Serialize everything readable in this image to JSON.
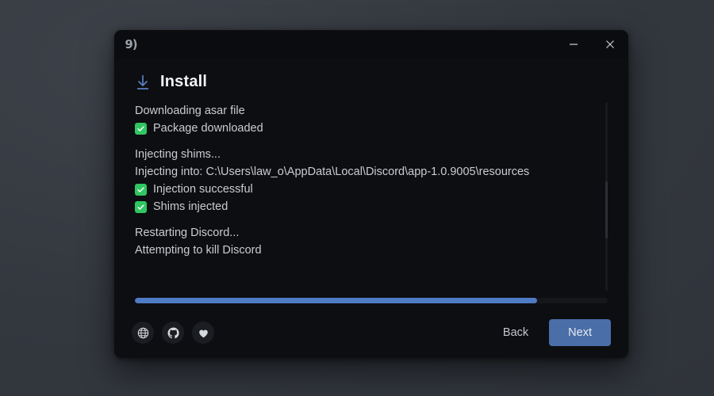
{
  "window": {
    "app_icon_glyph": "9)",
    "icon_name": "app-logo-icon",
    "minimize_label": "─",
    "close_label": "✕"
  },
  "page": {
    "icon": "download-icon",
    "title": "Install"
  },
  "log": {
    "lines": [
      {
        "text": "Downloading asar file",
        "check": false
      },
      {
        "text": "Package downloaded",
        "check": true
      },
      {
        "text": "",
        "check": false,
        "spacer": true
      },
      {
        "text": "Injecting shims...",
        "check": false
      },
      {
        "text": "Injecting into: C:\\Users\\law_o\\AppData\\Local\\Discord\\app-1.0.9005\\resources",
        "check": false
      },
      {
        "text": "Injection successful",
        "check": true
      },
      {
        "text": "Shims injected",
        "check": true
      },
      {
        "text": "",
        "check": false,
        "spacer": true
      },
      {
        "text": "Restarting Discord...",
        "check": false
      },
      {
        "text": "Attempting to kill Discord",
        "check": false
      }
    ]
  },
  "progress": {
    "percent": 85,
    "fill_color": "#4f7bc4",
    "track_color": "#15171b"
  },
  "footer": {
    "links": [
      {
        "icon": "globe-icon",
        "name": "website-link"
      },
      {
        "icon": "github-icon",
        "name": "github-link"
      },
      {
        "icon": "heart-icon",
        "name": "donate-link"
      }
    ],
    "back_label": "Back",
    "next_label": "Next",
    "next_color": "#4a6ea8"
  },
  "colors": {
    "checkbox_green": "#30c762",
    "accent_blue": "#4f7bc4",
    "window_bg": "#0d0e11",
    "desktop_bg": "#383c44"
  }
}
